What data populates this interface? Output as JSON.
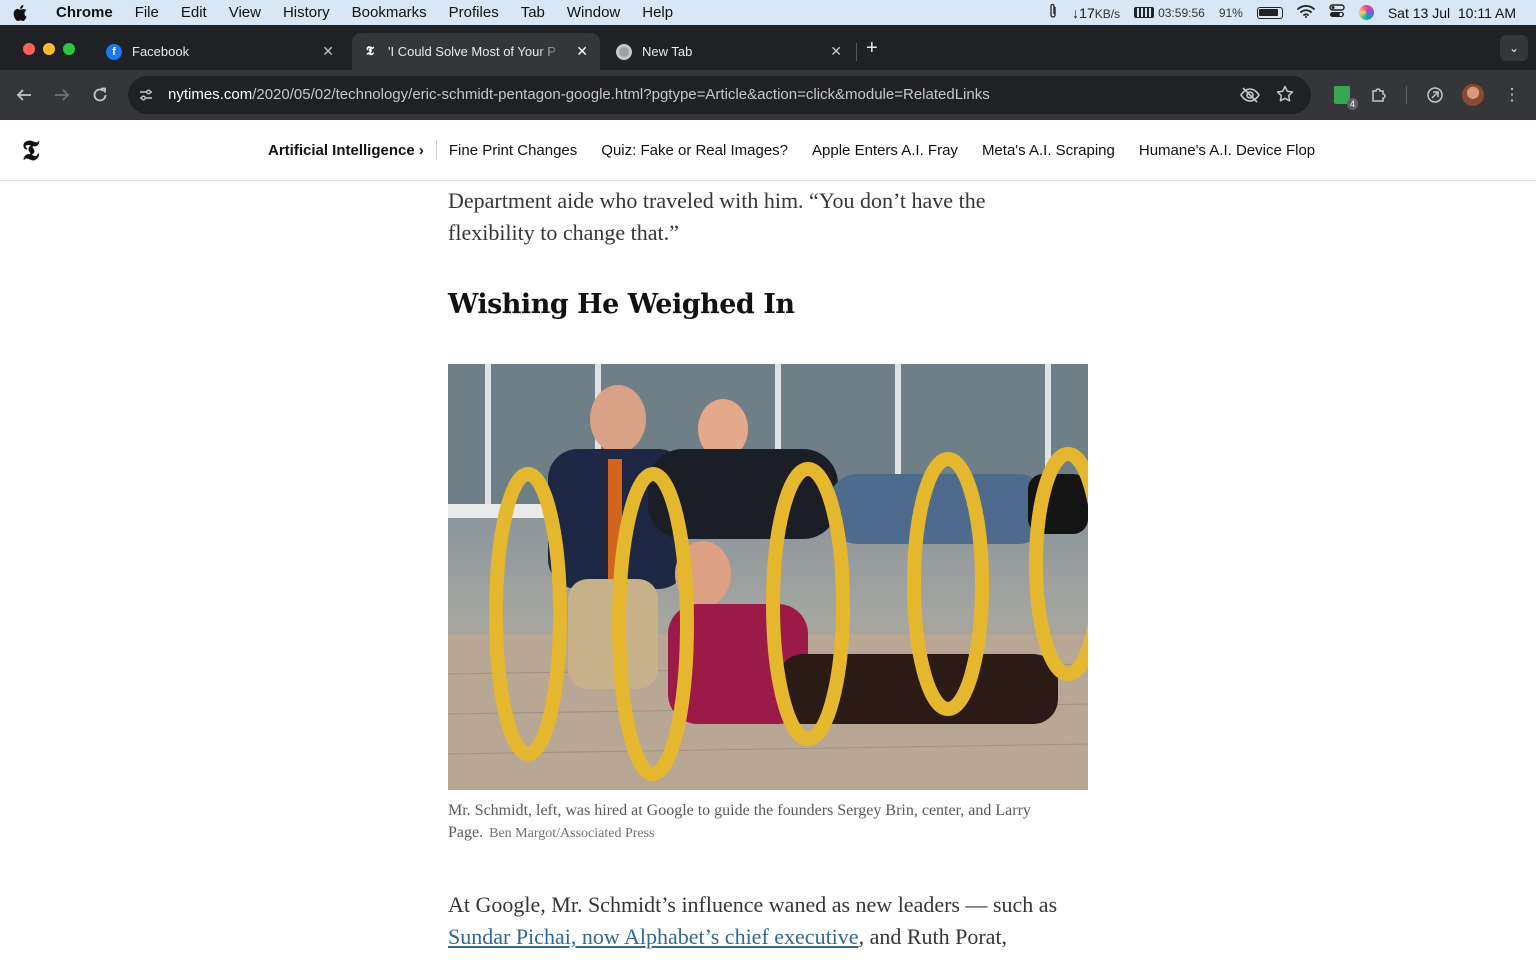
{
  "menubar": {
    "app": "Chrome",
    "items": [
      "File",
      "Edit",
      "View",
      "History",
      "Bookmarks",
      "Profiles",
      "Tab",
      "Window",
      "Help"
    ],
    "net_speed": "↓17",
    "net_unit": "KB/s",
    "timer": "03:59:56",
    "battery": "91%",
    "datetime": "Sat 13 Jul  10:11 AM"
  },
  "tabs": [
    {
      "title": "Facebook"
    },
    {
      "title": "'I Could Solve Most of Your P"
    },
    {
      "title": "New Tab"
    }
  ],
  "toolbar": {
    "url_host": "nytimes.com",
    "url_path": "/2020/05/02/technology/eric-schmidt-pentagon-google.html?pgtype=Article&action=click&module=RelatedLinks",
    "extension_badge": "4"
  },
  "nyt": {
    "logo": "𝕿",
    "section": "Artificial Intelligence ›",
    "links": [
      "Fine Print Changes",
      "Quiz: Fake or Real Images?",
      "Apple Enters A.I. Fray",
      "Meta's A.I. Scraping",
      "Humane's A.I. Device Flop"
    ]
  },
  "article": {
    "para1": "Department aide who traveled with him. “You don’t have the flexibility to change that.”",
    "heading": "Wishing He Weighed In",
    "caption": "Mr. Schmidt, left, was hired at Google to guide the founders Sergey Brin, center, and Larry Page.",
    "credit": "Ben Margot/Associated Press",
    "para2_start": "At Google, Mr. Schmidt’s influence waned as new leaders — such as ",
    "para2_link": "Sundar Pichai, now Alphabet’s chief executive",
    "para2_end": ", and Ruth Porat,"
  }
}
